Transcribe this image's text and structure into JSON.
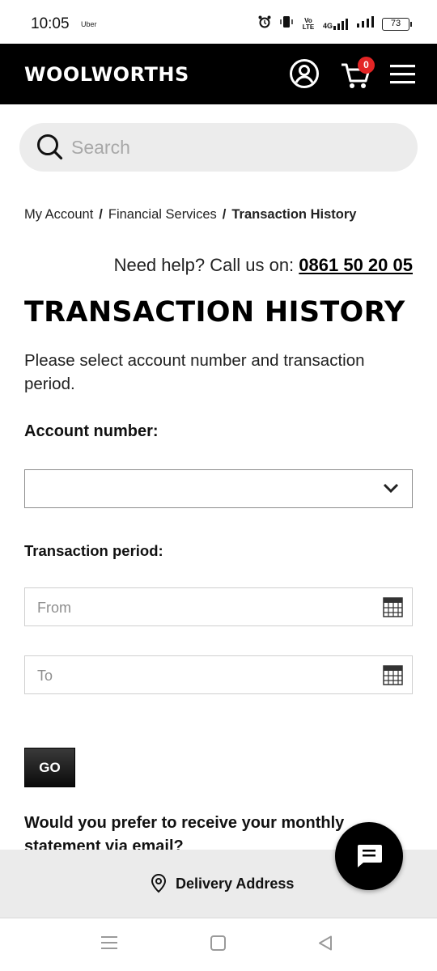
{
  "status_bar": {
    "time": "10:05",
    "app_label": "Uber",
    "volte": "Vo LTE",
    "network": "4G",
    "battery": "73"
  },
  "header": {
    "logo": "WOOLWORTHS",
    "cart_count": "0",
    "icons": [
      "account-icon",
      "cart-icon",
      "hamburger-menu-icon"
    ]
  },
  "search": {
    "placeholder": "Search",
    "icon": "search-icon"
  },
  "breadcrumb": {
    "items": [
      "My Account",
      "Financial Services",
      "Transaction History"
    ],
    "separator": "/"
  },
  "help": {
    "text": "Need help? Call us on:",
    "phone": "0861 50 20 05"
  },
  "page": {
    "title": "TRANSACTION HISTORY",
    "intro": "Please select account number and transaction period."
  },
  "form": {
    "account_label": "Account number:",
    "account_value": "",
    "period_label": "Transaction period:",
    "from_placeholder": "From",
    "to_placeholder": "To",
    "go_label": "GO",
    "email_question": "Would you prefer to receive your monthly statement via email?"
  },
  "delivery": {
    "label": "Delivery Address",
    "icon": "location-pin-icon"
  },
  "chat": {
    "icon": "chat-icon"
  },
  "colors": {
    "header_bg": "#000000",
    "badge": "#e32525",
    "search_bg": "#ececec",
    "delivery_bg": "#ebebeb"
  }
}
